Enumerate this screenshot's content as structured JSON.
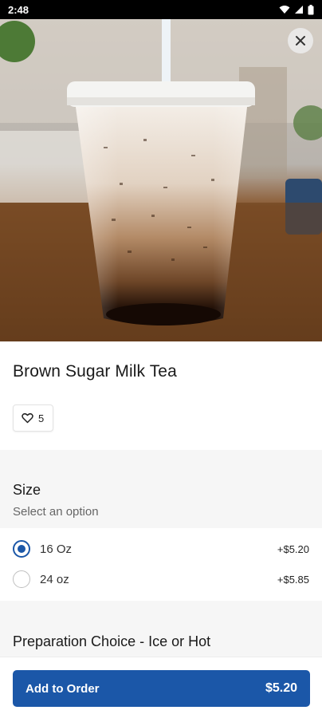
{
  "status_bar": {
    "time": "2:48",
    "icons": [
      "wifi-icon",
      "signal-icon",
      "battery-icon"
    ]
  },
  "hero": {
    "close_icon": "close-icon"
  },
  "item": {
    "title": "Brown Sugar Milk Tea",
    "likes": "5",
    "like_icon": "heart-outline-icon"
  },
  "size_section": {
    "title": "Size",
    "subtitle": "Select an option",
    "options": [
      {
        "label": "16 Oz",
        "price": "+$5.20",
        "selected": true
      },
      {
        "label": "24 oz",
        "price": "+$5.85",
        "selected": false
      }
    ]
  },
  "prep_section": {
    "title": "Preparation Choice - Ice or Hot"
  },
  "footer": {
    "button_label": "Add to Order",
    "total": "$5.20"
  },
  "colors": {
    "accent": "#1b57a8",
    "section_bg": "#f6f6f6"
  }
}
